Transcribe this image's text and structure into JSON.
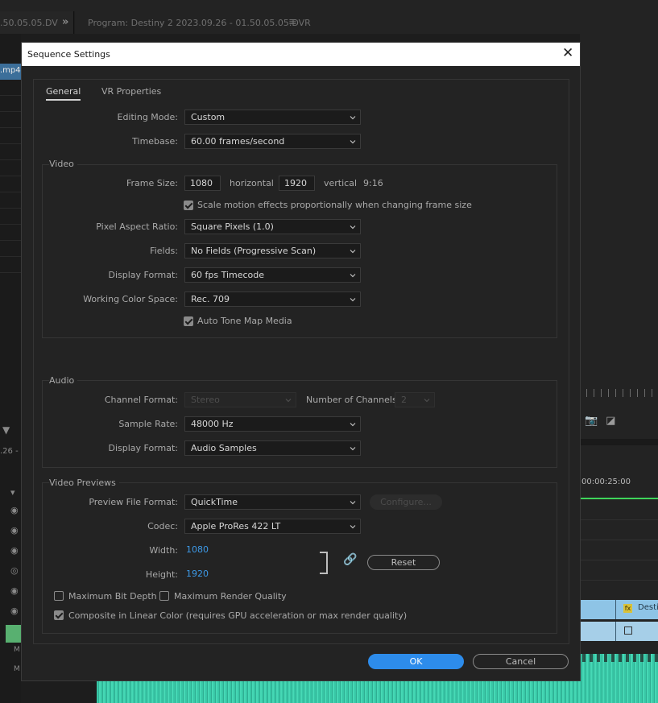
{
  "background": {
    "source_tab_text": ".50.05.05.DV",
    "program_title": "Program: Destiny 2 2023.09.26 - 01.50.05.05.DVR",
    "clip_name": ".mp4",
    "left_timecode": ".26 - (",
    "timeline_timecode": "00:00:25:00",
    "clip_fx_label": "fx",
    "clip_name_right": "Destin",
    "track_label": "M"
  },
  "dialog": {
    "title": "Sequence Settings",
    "tabs": [
      {
        "label": "General",
        "active": true
      },
      {
        "label": "VR Properties",
        "active": false
      }
    ],
    "editing_mode": {
      "label": "Editing Mode:",
      "value": "Custom"
    },
    "timebase": {
      "label": "Timebase:",
      "value": "60.00  frames/second"
    },
    "video": {
      "section_title": "Video",
      "frame_size": {
        "label": "Frame Size:",
        "width": "1080",
        "horizontal_label": "horizontal",
        "height": "1920",
        "vertical_label": "vertical",
        "ratio": "9:16"
      },
      "scale_motion": {
        "label": "Scale motion effects proportionally when changing frame size",
        "checked": true
      },
      "pixel_aspect_ratio": {
        "label": "Pixel Aspect Ratio:",
        "value": "Square Pixels (1.0)"
      },
      "fields": {
        "label": "Fields:",
        "value": "No Fields (Progressive Scan)"
      },
      "display_format": {
        "label": "Display Format:",
        "value": "60 fps Timecode"
      },
      "working_color_space": {
        "label": "Working Color Space:",
        "value": "Rec. 709"
      },
      "auto_tone_map": {
        "label": "Auto Tone Map Media",
        "checked": true
      }
    },
    "audio": {
      "section_title": "Audio",
      "channel_format": {
        "label": "Channel Format:",
        "value": "Stereo"
      },
      "number_of_channels": {
        "label": "Number of Channels:",
        "value": "2"
      },
      "sample_rate": {
        "label": "Sample Rate:",
        "value": "48000 Hz"
      },
      "display_format": {
        "label": "Display Format:",
        "value": "Audio Samples"
      }
    },
    "video_previews": {
      "section_title": "Video Previews",
      "preview_file_format": {
        "label": "Preview File Format:",
        "value": "QuickTime"
      },
      "configure_label": "Configure...",
      "codec": {
        "label": "Codec:",
        "value": "Apple ProRes 422 LT"
      },
      "width": {
        "label": "Width:",
        "value": "1080"
      },
      "height": {
        "label": "Height:",
        "value": "1920"
      },
      "reset_label": "Reset",
      "max_bit_depth": {
        "label": "Maximum Bit Depth",
        "checked": false
      },
      "max_render_quality": {
        "label": "Maximum Render Quality",
        "checked": false
      },
      "composite_linear": {
        "label": "Composite in Linear Color (requires GPU acceleration or max render quality)",
        "checked": true
      }
    },
    "ok_label": "OK",
    "cancel_label": "Cancel"
  },
  "colors": {
    "accent": "#2d8ceb",
    "link_value": "#3d9ae8",
    "dialog_bg": "#232323",
    "waveform": "#38c7a6"
  }
}
